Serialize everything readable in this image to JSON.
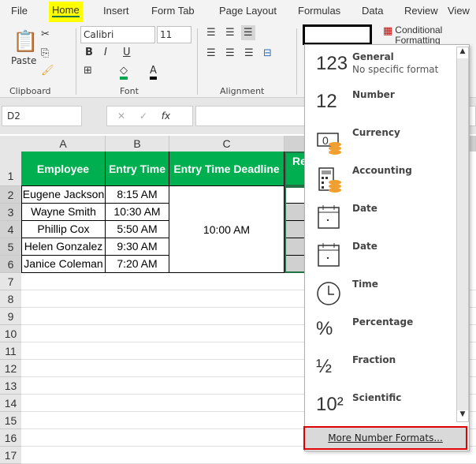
{
  "tabs": [
    "File",
    "Home",
    "Insert",
    "Form Tab",
    "Page Layout",
    "Formulas",
    "Data",
    "Review",
    "View"
  ],
  "ribbon": {
    "paste": "Paste",
    "clipboard": "Clipboard",
    "font_name": "Calibri",
    "font_size": "11",
    "font": "Font",
    "alignment": "Alignment",
    "number_format_value": "",
    "conditional_formatting": "Conditional Formatting",
    "bold": "B",
    "italic": "I",
    "underline": "U"
  },
  "formula_bar": {
    "name_box": "D2",
    "value": "",
    "fx": "fx"
  },
  "columns": [
    "A",
    "B",
    "C"
  ],
  "rows": [
    "1",
    "2",
    "3",
    "4",
    "5",
    "6",
    "7",
    "8",
    "9",
    "10",
    "11",
    "12",
    "13",
    "14",
    "15",
    "16",
    "17"
  ],
  "headers": [
    "Employee",
    "Entry Time",
    "Entry Time Deadline",
    "Re"
  ],
  "employees": [
    {
      "name": "Eugene Jackson",
      "time": "8:15 AM"
    },
    {
      "name": "Wayne Smith",
      "time": "10:30 AM"
    },
    {
      "name": "Phillip Cox",
      "time": "5:50 AM"
    },
    {
      "name": "Helen Gonzalez",
      "time": "9:30 AM"
    },
    {
      "name": "Janice Coleman",
      "time": "7:20 AM"
    }
  ],
  "deadline": "10:00 AM",
  "colors": {
    "header_green": "#00b050",
    "highlight": "#ffff00",
    "more_border": "#e00000"
  },
  "dropdown": {
    "items": [
      {
        "label": "General",
        "sub": "No specific format",
        "icon": "123"
      },
      {
        "label": "Number",
        "icon": "12"
      },
      {
        "label": "Currency",
        "icon": "currency-icon"
      },
      {
        "label": "Accounting",
        "icon": "accounting-icon"
      },
      {
        "label": "Date",
        "icon": "calendar-icon"
      },
      {
        "label": "Date",
        "icon": "calendar-icon"
      },
      {
        "label": "Time",
        "icon": "clock-icon"
      },
      {
        "label": "Percentage",
        "icon": "%"
      },
      {
        "label": "Fraction",
        "icon": "½"
      },
      {
        "label": "Scientific",
        "icon": "10²"
      }
    ],
    "more": "More Number Formats..."
  }
}
